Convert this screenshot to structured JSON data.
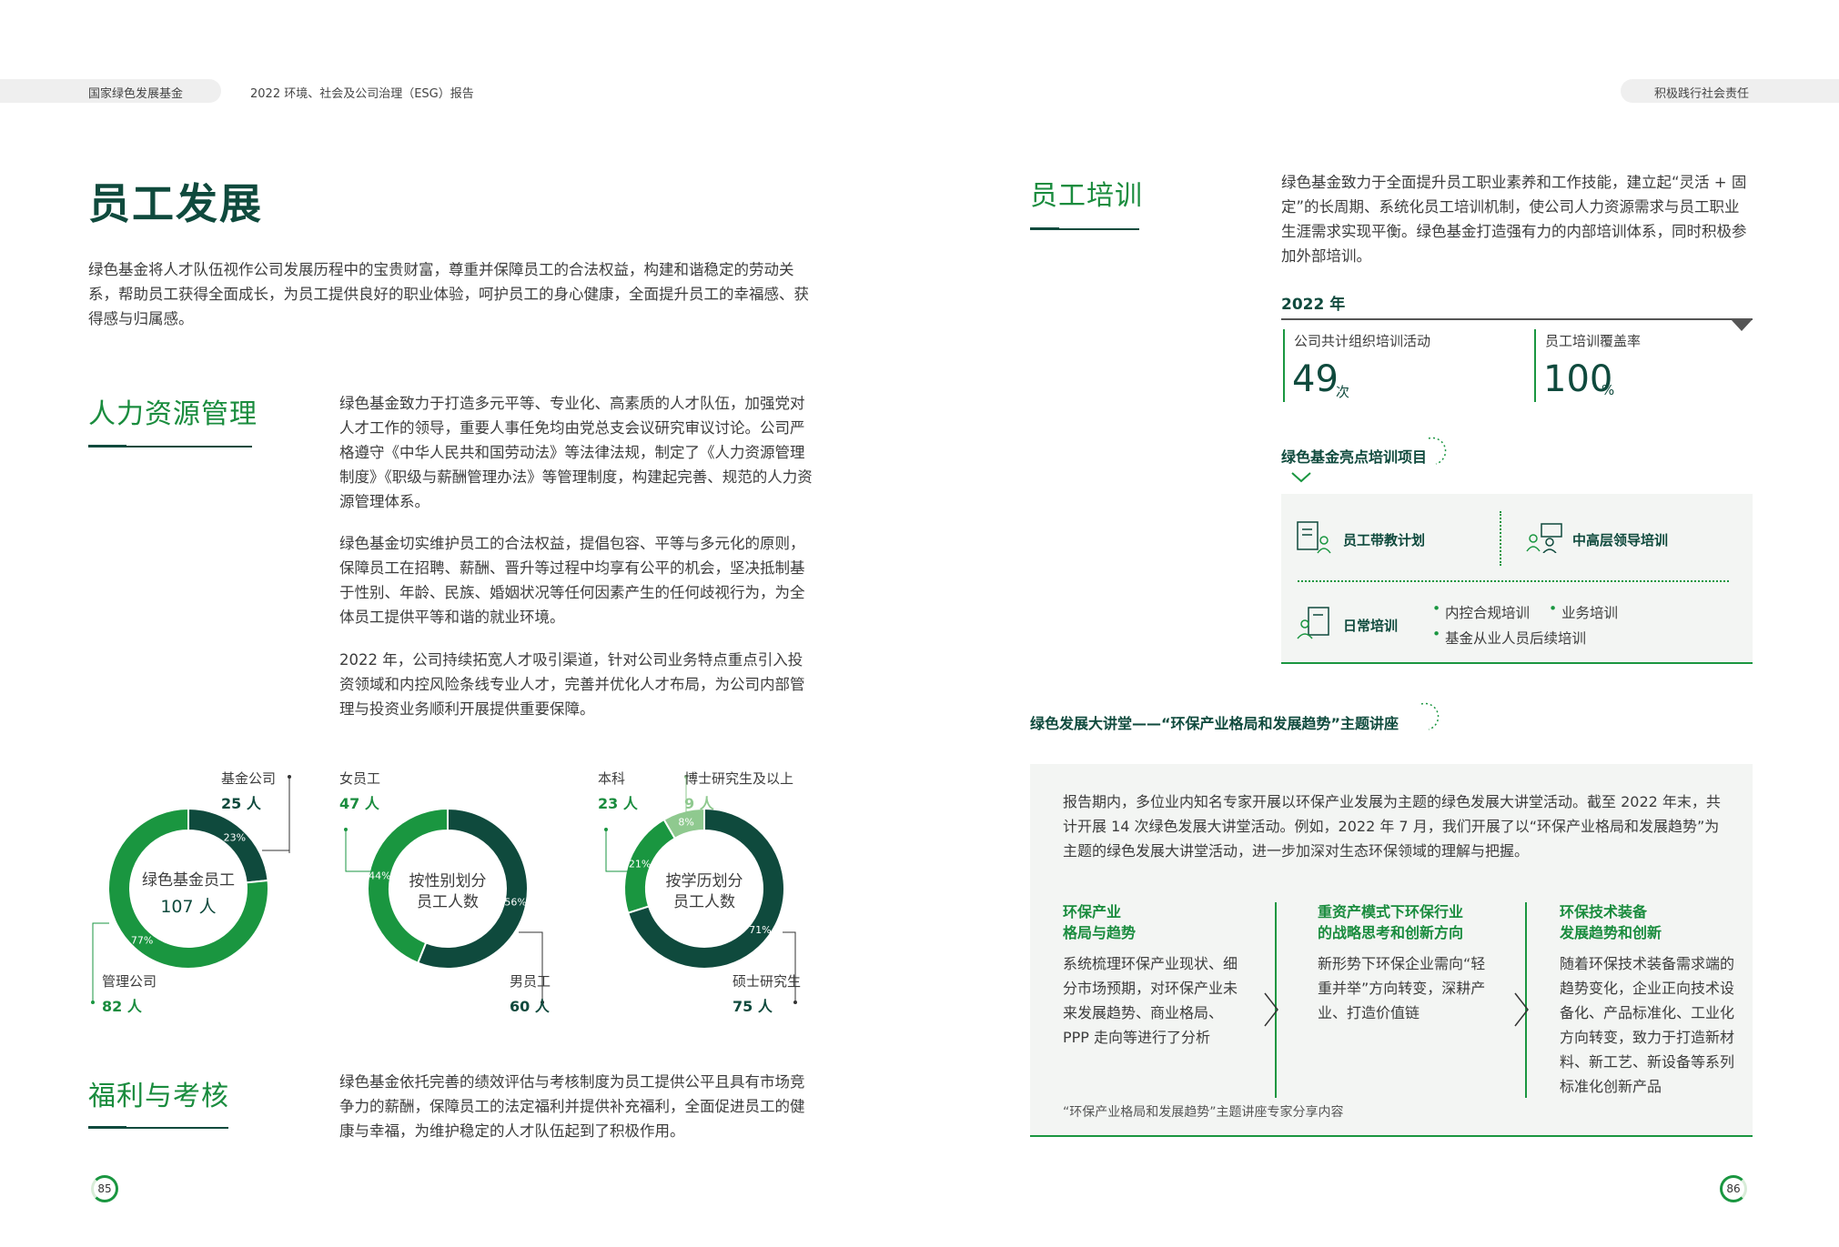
{
  "header": {
    "org": "国家绿色发展基金",
    "report": "2022 环境、社会及公司治理（ESG）报告",
    "section": "积极践行社会责任"
  },
  "left": {
    "title": "员工发展",
    "intro": "绿色基金将人才队伍视作公司发展历程中的宝贵财富，尊重并保障员工的合法权益，构建和谐稳定的劳动关系，帮助员工获得全面成长，为员工提供良好的职业体验，呵护员工的身心健康，全面提升员工的幸福感、获得感与归属感。",
    "hr": {
      "title": "人力资源管理",
      "p1": "绿色基金致力于打造多元平等、专业化、高素质的人才队伍，加强党对人才工作的领导，重要人事任免均由党总支会议研究审议讨论。公司严格遵守《中华人民共和国劳动法》等法律法规，制定了《人力资源管理制度》《职级与薪酬管理办法》等管理制度，构建起完善、规范的人力资源管理体系。",
      "p2": "绿色基金切实维护员工的合法权益，提倡包容、平等与多元化的原则，保障员工在招聘、薪酬、晋升等过程中均享有公平的机会，坚决抵制基于性别、年龄、民族、婚姻状况等任何因素产生的任何歧视行为，为全体员工提供平等和谐的就业环境。",
      "p3": "2022 年，公司持续拓宽人才吸引渠道，针对公司业务特点重点引入投资领域和内控风险条线专业人才，完善并优化人才布局，为公司内部管理与投资业务顺利开展提供重要保障。"
    },
    "welfare": {
      "title": "福利与考核",
      "p": "绿色基金依托完善的绩效评估与考核制度为员工提供公平且具有市场竞争力的薪酬，保障员工的法定福利并提供补充福利，全面促进员工的健康与幸福，为维护稳定的人才队伍起到了积极作用。"
    },
    "page_no": "85"
  },
  "chart_data": [
    {
      "type": "pie",
      "center": [
        "绿色基金员工",
        "107 人"
      ],
      "slices": [
        {
          "name": "基金公司",
          "value_label": "25 人",
          "value": 25,
          "pct": "23%",
          "color": "#0f4a3d"
        },
        {
          "name": "管理公司",
          "value_label": "82 人",
          "value": 82,
          "pct": "77%",
          "color": "#1a9640"
        }
      ]
    },
    {
      "type": "pie",
      "center": [
        "按性别划分",
        "员工人数"
      ],
      "slices": [
        {
          "name": "男员工",
          "value_label": "60 人",
          "value": 60,
          "pct": "56%",
          "color": "#0f4a3d"
        },
        {
          "name": "女员工",
          "value_label": "47 人",
          "value": 47,
          "pct": "44%",
          "color": "#1a9640"
        }
      ]
    },
    {
      "type": "pie",
      "center": [
        "按学历划分",
        "员工人数"
      ],
      "slices": [
        {
          "name": "硕士研究生",
          "value_label": "75 人",
          "value": 75,
          "pct": "71%",
          "color": "#0f4a3d"
        },
        {
          "name": "本科",
          "value_label": "23 人",
          "value": 23,
          "pct": "21%",
          "color": "#1a9640"
        },
        {
          "name": "博士研究生及以上",
          "value_label": "9 人",
          "value": 9,
          "pct": "8%",
          "color": "#8fc98f"
        }
      ]
    }
  ],
  "right": {
    "training": {
      "title": "员工培训",
      "intro": "绿色基金致力于全面提升员工职业素养和工作技能，建立起“灵活 + 固定”的长周期、系统化员工培训机制，使公司人力资源需求与员工职业生涯需求实现平衡。绿色基金打造强有力的内部培训体系，同时积极参加外部培训。",
      "year": "2022 年",
      "stat1_label": "公司共计组织培训活动",
      "stat1_value": "49",
      "stat1_unit": "次",
      "stat2_label": "员工培训覆盖率",
      "stat2_value": "100",
      "stat2_unit": "%"
    },
    "highlight": {
      "title": "绿色基金亮点培训项目",
      "item1": "员工带教计划",
      "item2": "中高层领导培训",
      "item3": "日常培训",
      "sub1": "内控合规培训",
      "sub2": "业务培训",
      "sub3": "基金从业人员后续培训"
    },
    "lecture": {
      "title": "绿色发展大讲堂——“环保产业格局和发展趋势”主题讲座",
      "intro": "报告期内，多位业内知名专家开展以环保产业发展为主题的绿色发展大讲堂活动。截至 2022 年末，共计开展 14 次绿色发展大讲堂活动。例如，2022 年 7 月，我们开展了以“环保产业格局和发展趋势”为主题的绿色发展大讲堂活动，进一步加深对生态环保领域的理解与把握。",
      "col1_title1": "环保产业",
      "col1_title2": "格局与趋势",
      "col1_text": "系统梳理环保产业现状、细分市场预期，对环保产业未来发展趋势、商业格局、PPP 走向等进行了分析",
      "col2_title1": "重资产模式下环保行业",
      "col2_title2": "的战略思考和创新方向",
      "col2_text": "新形势下环保企业需向“轻重并举”方向转变，深耕产业、打造价值链",
      "col3_title1": "环保技术装备",
      "col3_title2": "发展趋势和创新",
      "col3_text": "随着环保技术装备需求端的趋势变化，企业正向技术设备化、产品标准化、工业化方向转变，致力于打造新材料、新工艺、新设备等系列标准化创新产品",
      "caption": "“环保产业格局和发展趋势”主题讲座专家分享内容"
    },
    "page_no": "86"
  }
}
